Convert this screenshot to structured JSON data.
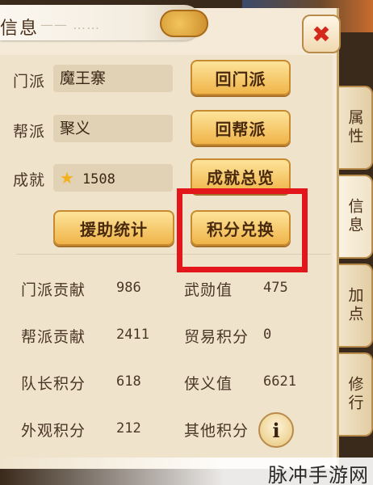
{
  "window": {
    "title": "信息",
    "title_decoration": "—— ……"
  },
  "profile": {
    "faction_label": "门派",
    "faction_value": "魔王寨",
    "gang_label": "帮派",
    "gang_value": "聚义",
    "achievement_label": "成就",
    "achievement_value": "1508"
  },
  "buttons": {
    "return_faction": "回门派",
    "return_gang": "回帮派",
    "achievement_overview": "成就总览",
    "assist_stats": "援助统计",
    "points_exchange": "积分兑换"
  },
  "stats": [
    {
      "label": "门派贡献",
      "value": "986"
    },
    {
      "label": "武勋值",
      "value": "475"
    },
    {
      "label": "帮派贡献",
      "value": "2411"
    },
    {
      "label": "贸易积分",
      "value": "0"
    },
    {
      "label": "队长积分",
      "value": "618"
    },
    {
      "label": "侠义值",
      "value": "6621"
    },
    {
      "label": "外观积分",
      "value": "212"
    },
    {
      "label": "其他积分",
      "value": ""
    }
  ],
  "info_button": "i",
  "tabs": [
    "属性",
    "信息",
    "加点",
    "修行"
  ],
  "watermark": "脉冲手游网",
  "colors": {
    "highlight": "#e3161b",
    "button_gold": "#f0b449",
    "close_red": "#d4281c"
  },
  "icons": {
    "close": "close-icon",
    "achievement": "star-icon",
    "info": "info-icon"
  }
}
